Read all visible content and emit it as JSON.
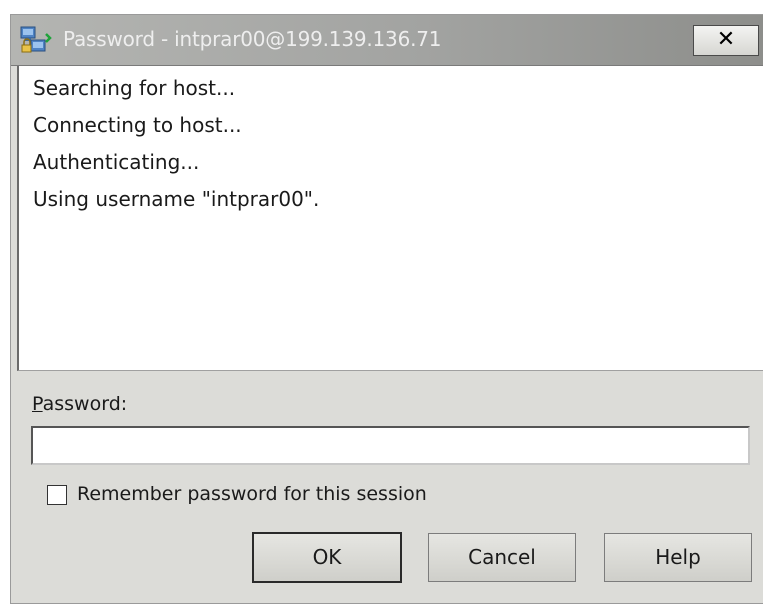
{
  "window": {
    "title": "Password - intprar00@199.139.136.71",
    "close_label": "✕"
  },
  "log": {
    "lines": [
      "Searching for host...",
      "Connecting to host...",
      "Authenticating...",
      "Using username \"intprar00\"."
    ]
  },
  "password": {
    "label_mnemonic": "P",
    "label_rest": "assword:",
    "value": ""
  },
  "remember": {
    "label": "Remember password for this session",
    "checked": false
  },
  "buttons": {
    "ok": "OK",
    "cancel": "Cancel",
    "help": "Help"
  },
  "icons": {
    "app": "putty-terminal-icon",
    "close": "close-icon"
  }
}
